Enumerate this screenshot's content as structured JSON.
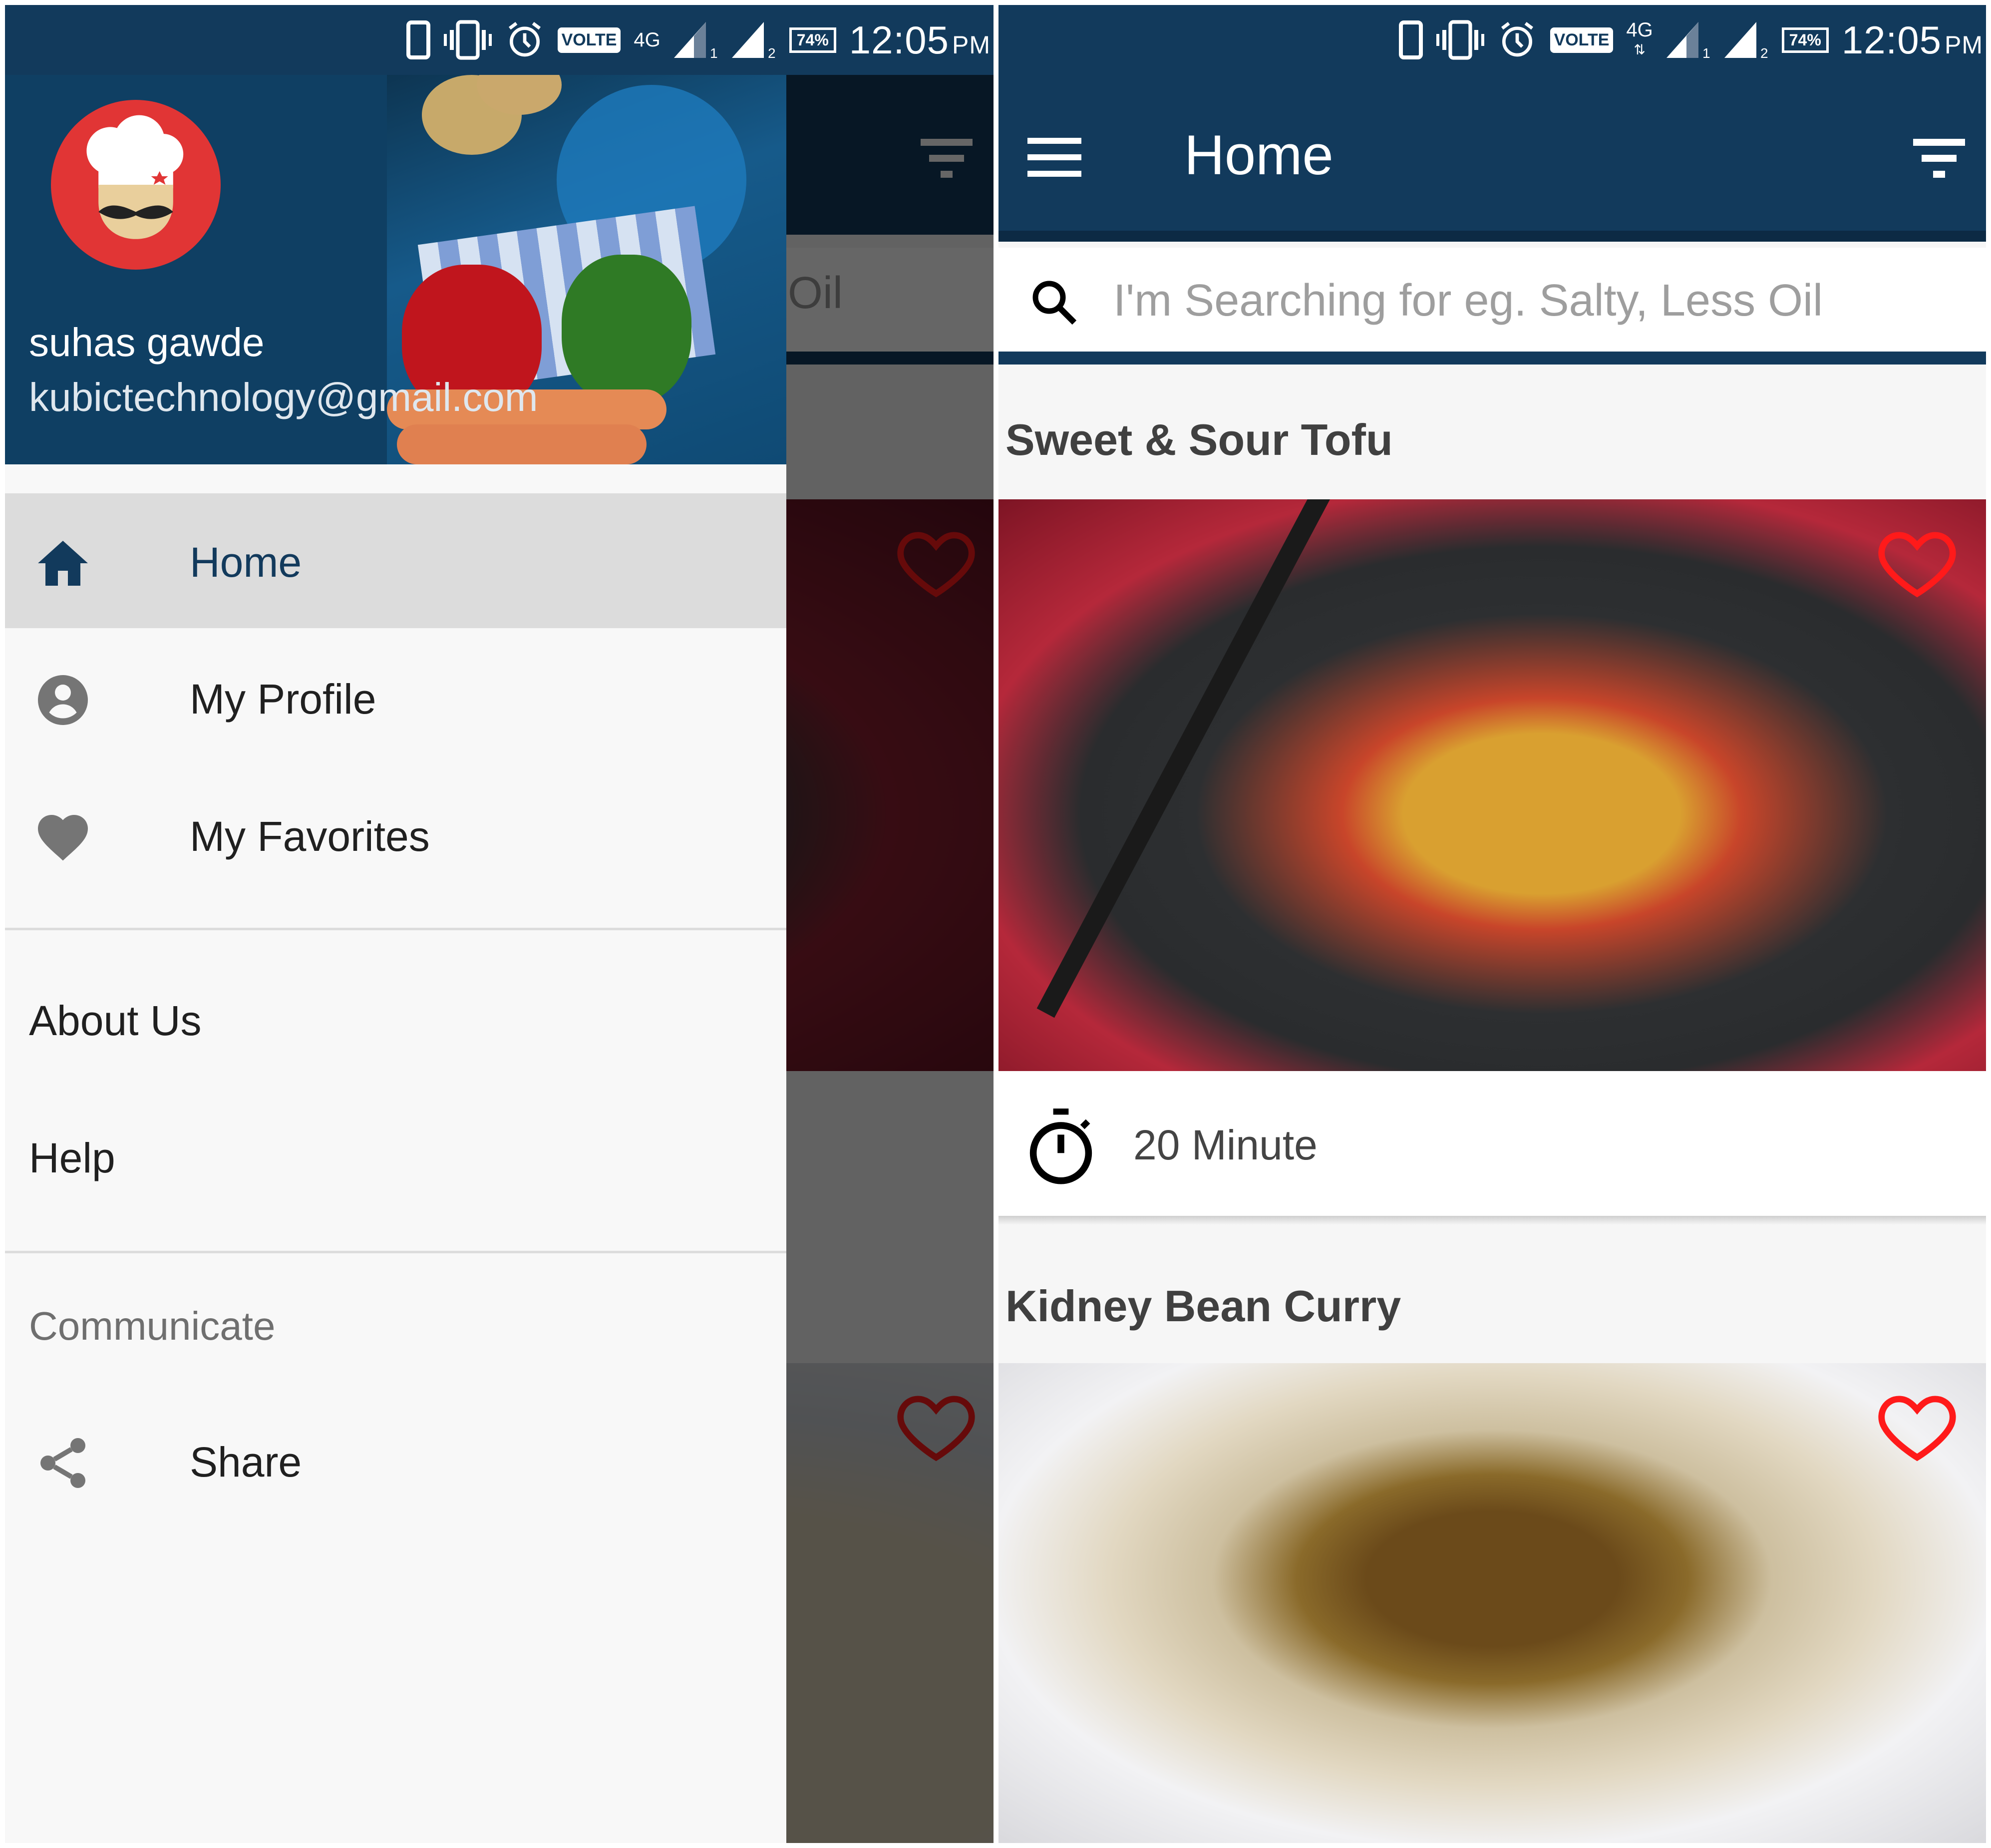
{
  "status_bar": {
    "volte_label": "VOLTE",
    "network_label": "4G",
    "sim1_label": "1",
    "sim2_label": "2",
    "battery": "74%",
    "time": "12:05",
    "ampm": "PM",
    "icons": [
      "phone-icon",
      "vibrate-icon",
      "alarm-icon",
      "volte-badge",
      "4g-icon",
      "signal-sim1-icon",
      "signal-sim2-icon",
      "battery-icon"
    ]
  },
  "drawer": {
    "user_name": "suhas gawde",
    "user_email": "kubictechnology@gmail.com",
    "primary_items": [
      {
        "label": "Home",
        "icon": "home-icon",
        "active": true
      },
      {
        "label": "My Profile",
        "icon": "account-circle-icon",
        "active": false
      },
      {
        "label": "My Favorites",
        "icon": "heart-icon",
        "active": false
      }
    ],
    "secondary_items": [
      {
        "label": "About Us"
      },
      {
        "label": "Help"
      }
    ],
    "section_header": "Communicate",
    "communicate_items": [
      {
        "label": "Share",
        "icon": "share-icon"
      }
    ],
    "background_partial_text": "Oil"
  },
  "main": {
    "title": "Home",
    "search": {
      "placeholder": "I'm Searching for eg. Salty, Less Oil",
      "value": ""
    },
    "recipes": [
      {
        "title": "Sweet & Sour Tofu",
        "time": "20 Minute",
        "favorite": false
      },
      {
        "title": "Kidney Bean Curry",
        "favorite": false
      }
    ]
  },
  "colors": {
    "primary": "#123a5c",
    "favorite_heart": "#ff1a1a",
    "avatar_bg": "#e13535",
    "drawer_active_bg": "#dcdcdc"
  }
}
